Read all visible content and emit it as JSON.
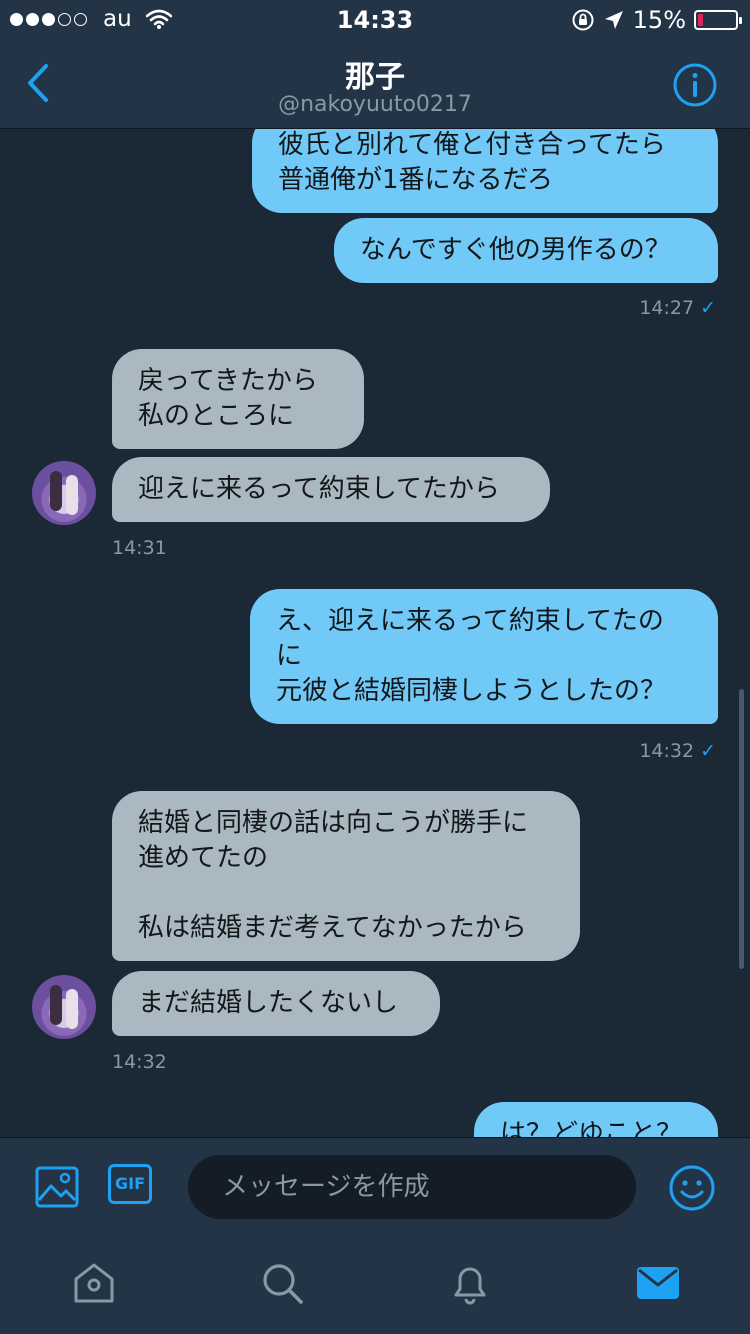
{
  "status_bar": {
    "carrier": "au",
    "time": "14:33",
    "battery": "15%",
    "signal_bars_filled": 3,
    "signal_bars_total": 5
  },
  "header": {
    "name": "那子",
    "handle": "@nakoyuuto0217"
  },
  "messages": [
    {
      "dir": "out",
      "text": "彼氏と別れて俺と付き合ってたら\n普通俺が1番になるだろ"
    },
    {
      "dir": "out",
      "text": "なんですぐ他の男作るの？"
    },
    {
      "dir": "out-ts",
      "time": "14:27"
    },
    {
      "dir": "in",
      "text": "戻ってきたから\n私のところに"
    },
    {
      "dir": "in",
      "text": "迎えに来るって約束してたから"
    },
    {
      "dir": "in-ts",
      "time": "14:31"
    },
    {
      "dir": "out",
      "text": "え、迎えに来るって約束してたの\nに\n元彼と結婚同棲しようとしたの？"
    },
    {
      "dir": "out-ts",
      "time": "14:32"
    },
    {
      "dir": "in",
      "text": "結婚と同棲の話は向こうが勝手に\n進めてたの\n\n私は結婚まだ考えてなかったから"
    },
    {
      "dir": "in",
      "text": "まだ結婚したくないし"
    },
    {
      "dir": "in-ts",
      "time": "14:32"
    },
    {
      "dir": "out",
      "text": "は？どゆこと？"
    }
  ],
  "read_check": "✓",
  "composer": {
    "placeholder": "メッセージを作成",
    "gif_label": "GIF"
  },
  "tabs": [
    "home-icon",
    "search-icon",
    "notifications-icon",
    "messages-icon"
  ],
  "colors": {
    "background": "#1b2836",
    "bar": "#243447",
    "accent": "#1da1f2",
    "outgoing_bubble": "#71c9f8",
    "incoming_bubble": "#aab8c2",
    "battery_low": "#e0245e"
  }
}
